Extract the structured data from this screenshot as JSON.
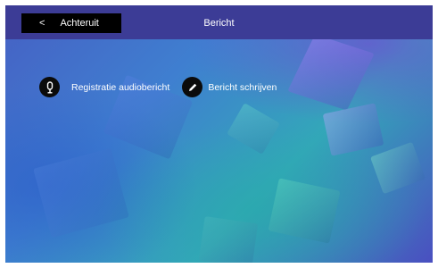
{
  "header": {
    "back_label": "Achteruit",
    "back_icon": "chevron-left-icon",
    "title": "Bericht"
  },
  "menu": {
    "items": [
      {
        "label": "Registratie audiobericht",
        "icon": "microphone-icon"
      },
      {
        "label": "Bericht schrijven",
        "icon": "pencil-icon"
      }
    ]
  },
  "colors": {
    "header_bg": "#3c3c96",
    "button_bg": "#000000",
    "text": "#ffffff"
  }
}
